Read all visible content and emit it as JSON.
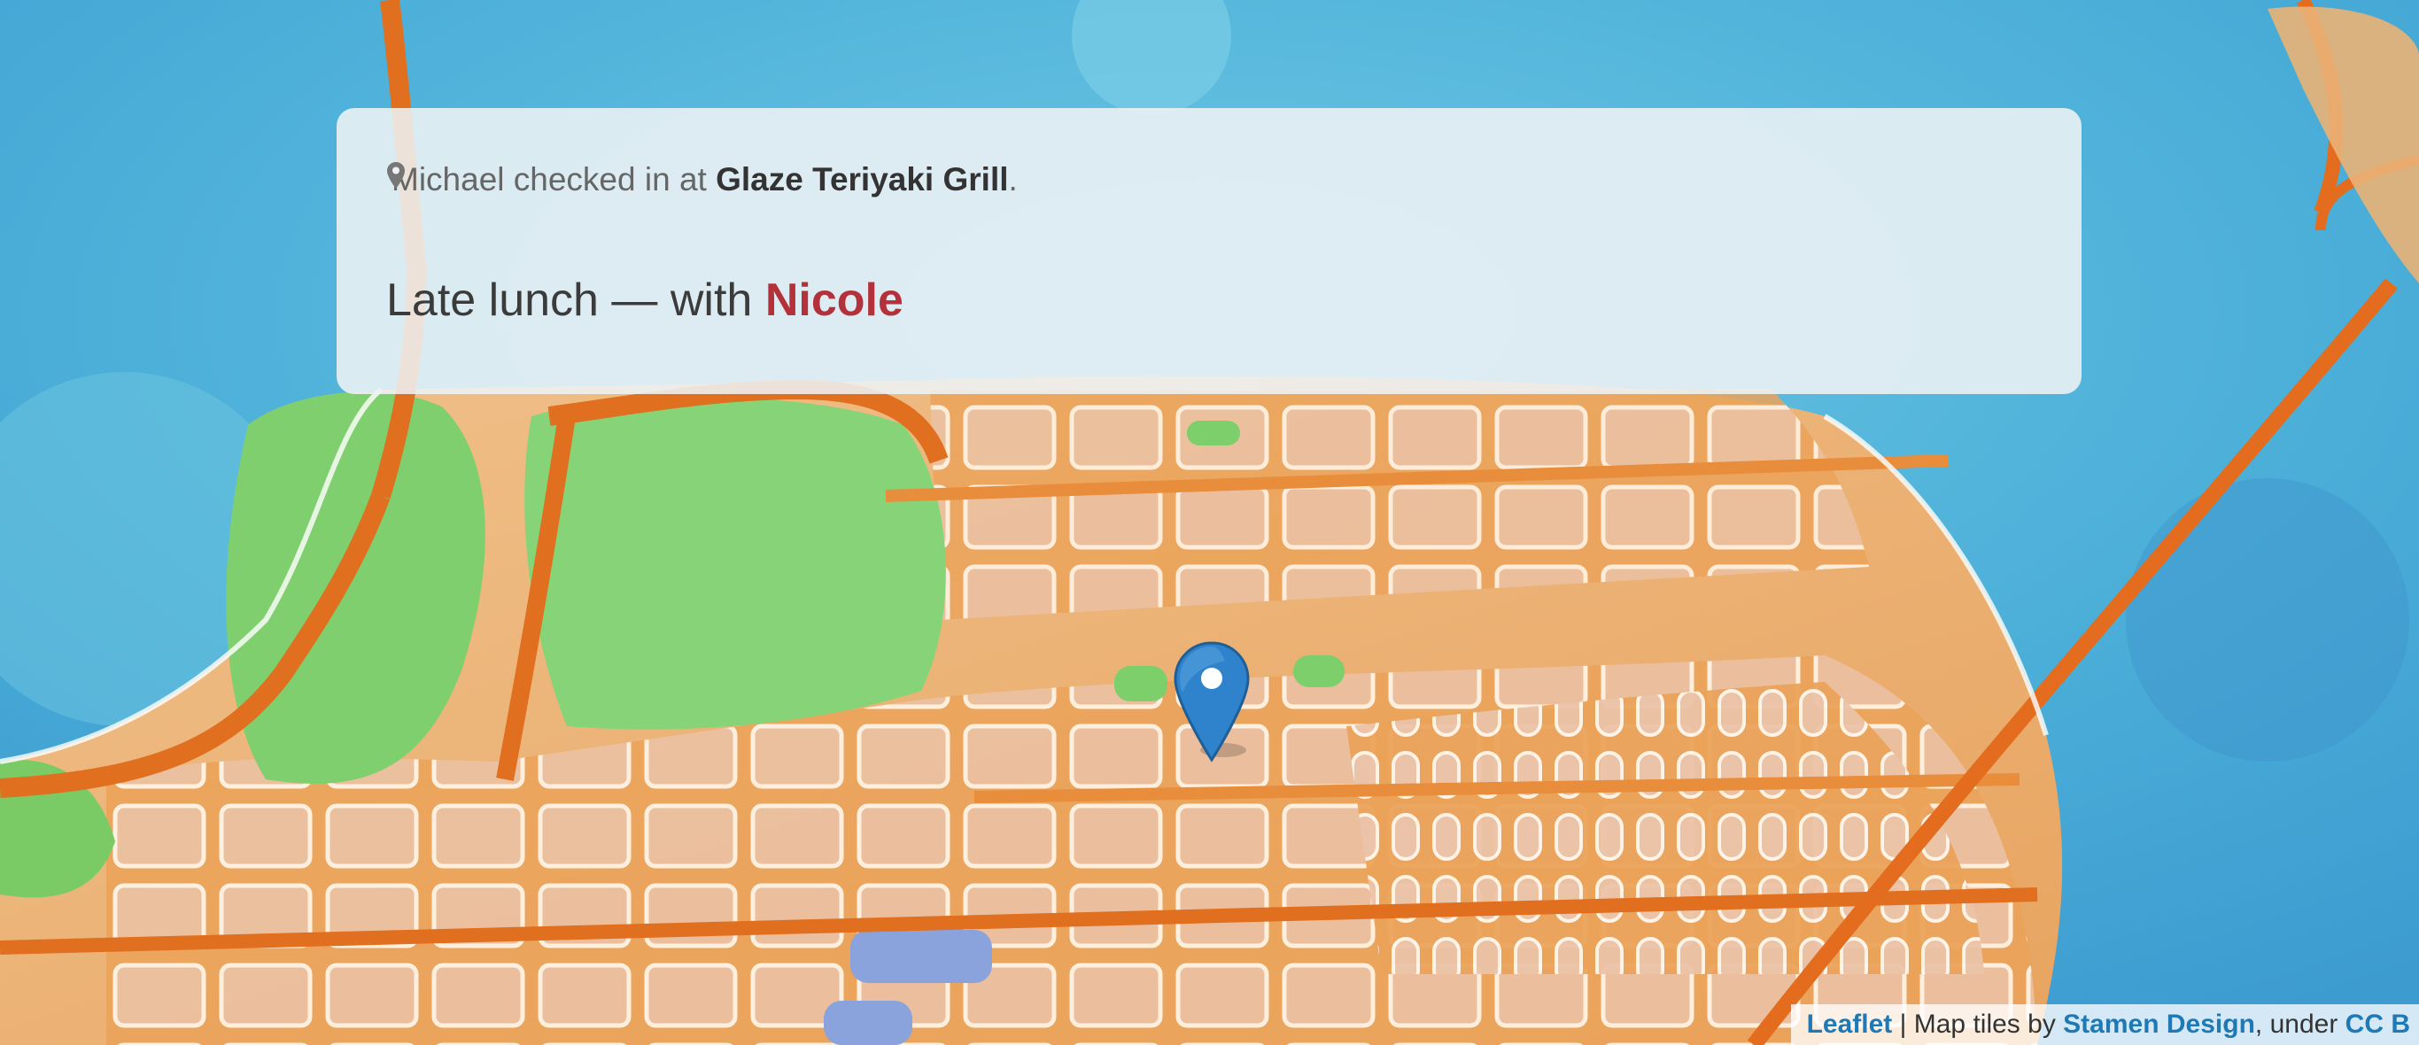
{
  "checkin": {
    "icon": "map-pin-icon",
    "user": "Michael",
    "action_text": "checked in at",
    "place": "Glaze Teriyaki Grill",
    "period": ".",
    "message": "Late lunch",
    "separator": "—",
    "with_text": "with",
    "friend": "Nicole"
  },
  "map": {
    "marker_icon": "map-marker-icon",
    "colors": {
      "water": "#5cb8d9",
      "park": "#7fcf6e",
      "land": "#e9b377",
      "road": "#e67a2b",
      "marker": "#2a81cb",
      "friend": "#b3313a"
    }
  },
  "attribution": {
    "leaflet": "Leaflet",
    "divider": " | ",
    "tiles_by": "Map tiles by",
    "stamen": "Stamen Design",
    "under": ", under",
    "license": "CC B"
  }
}
